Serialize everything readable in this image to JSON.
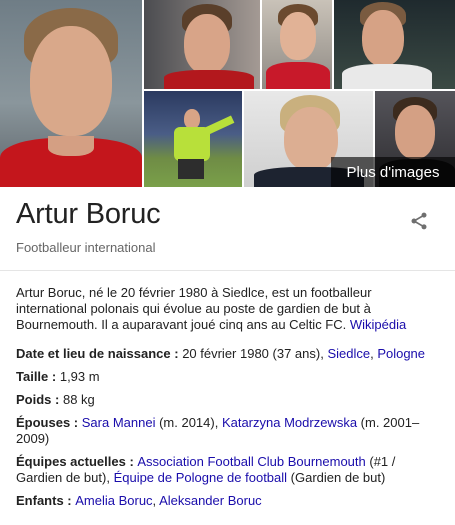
{
  "header": {
    "title": "Artur Boruc",
    "subtitle": "Footballeur international"
  },
  "gallery": {
    "more_images_label": "Plus d'images"
  },
  "description": {
    "text": "Artur Boruc, né le 20 février 1980 à Siedlce, est un footballeur international polonais qui évolue au poste de gardien de but à Bournemouth. Il a auparavant joué cinq ans au Celtic FC. ",
    "source_link": "Wikipédia"
  },
  "facts": {
    "birth": {
      "label": "Date et lieu de naissance",
      "value": "20 février 1980 (37 ans), ",
      "links": [
        "Siedlce",
        "Pologne"
      ]
    },
    "height": {
      "label": "Taille",
      "value": "1,93 m"
    },
    "weight": {
      "label": "Poids",
      "value": "88 kg"
    },
    "spouses": {
      "label": "Épouses",
      "link1": "Sara Mannei",
      "text1": " (m. 2014), ",
      "link2": "Katarzyna Modrzewska",
      "text2": " (m. 2001–2009)"
    },
    "teams": {
      "label": "Équipes actuelles",
      "link1": "Association Football Club Bournemouth",
      "text1": " (#1 / Gardien de but), ",
      "link2": "Équipe de Pologne de football",
      "text2": " (Gardien de but)"
    },
    "children": {
      "label": "Enfants",
      "links": [
        "Amelia Boruc",
        "Aleksander Boruc"
      ]
    }
  },
  "icons": {
    "share": "share-icon"
  }
}
